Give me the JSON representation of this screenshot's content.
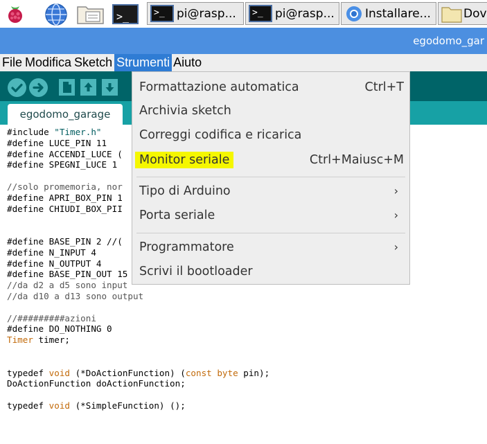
{
  "taskbar": {
    "icons": [
      "raspberry-menu-icon",
      "globe-icon",
      "file-manager-icon",
      "terminal-icon"
    ],
    "tasks": [
      {
        "label": "pi@rasp...",
        "icon": "terminal-icon"
      },
      {
        "label": "pi@rasp...",
        "icon": "terminal-icon"
      },
      {
        "label": "Installare...",
        "icon": "chromium-icon"
      },
      {
        "label": "Dov",
        "icon": "folder-icon"
      }
    ],
    "terminal_prompt": ">_"
  },
  "window": {
    "title": "egodomo_gar"
  },
  "menubar": {
    "items": [
      "File",
      "Modifica",
      "Sketch",
      "Strumenti",
      "Aiuto"
    ],
    "active": "Strumenti"
  },
  "toolbar": {
    "buttons": [
      "verify-icon",
      "upload-icon",
      "new-icon",
      "open-icon",
      "save-icon"
    ],
    "color": "#006468"
  },
  "tabs": [
    {
      "label": "egodomo_garage"
    }
  ],
  "dropdown": {
    "items": [
      {
        "label": "Formattazione automatica",
        "shortcut": "Ctrl+T"
      },
      {
        "label": "Archivia sketch",
        "shortcut": ""
      },
      {
        "label": "Correggi codifica e ricarica",
        "shortcut": ""
      },
      {
        "label": "Monitor seriale",
        "shortcut": "Ctrl+Maiusc+M",
        "highlight": "#f5f700"
      },
      {
        "label": "Tipo di Arduino",
        "submenu": true
      },
      {
        "label": "Porta seriale",
        "submenu": true
      },
      {
        "label": "Programmatore",
        "submenu": true
      },
      {
        "label": "Scrivi il bootloader",
        "shortcut": ""
      }
    ],
    "submenu_arrow": "›"
  },
  "code": {
    "lines": [
      "#include \"Timer.h\"",
      "#define LUCE_PIN 11",
      "#define ACCENDI_LUCE (",
      "#define SPEGNI_LUCE 1",
      "",
      "//solo promemoria, nor",
      "#define APRI_BOX_PIN 1",
      "#define CHIUDI_BOX_PII",
      "",
      "",
      "#define BASE_PIN 2 //(",
      "#define N_INPUT 4",
      "#define N_OUTPUT 4",
      "#define BASE_PIN_OUT 15",
      "//da d2 a d5 sono input",
      "//da d10 a d13 sono output",
      "",
      "//#########azioni",
      "#define DO_NOTHING 0",
      "Timer timer;",
      "",
      "",
      "typedef void (*DoActionFunction) (const byte pin);",
      "DoActionFunction doActionFunction;",
      "",
      "typedef void (*SimpleFunction) ();"
    ]
  }
}
